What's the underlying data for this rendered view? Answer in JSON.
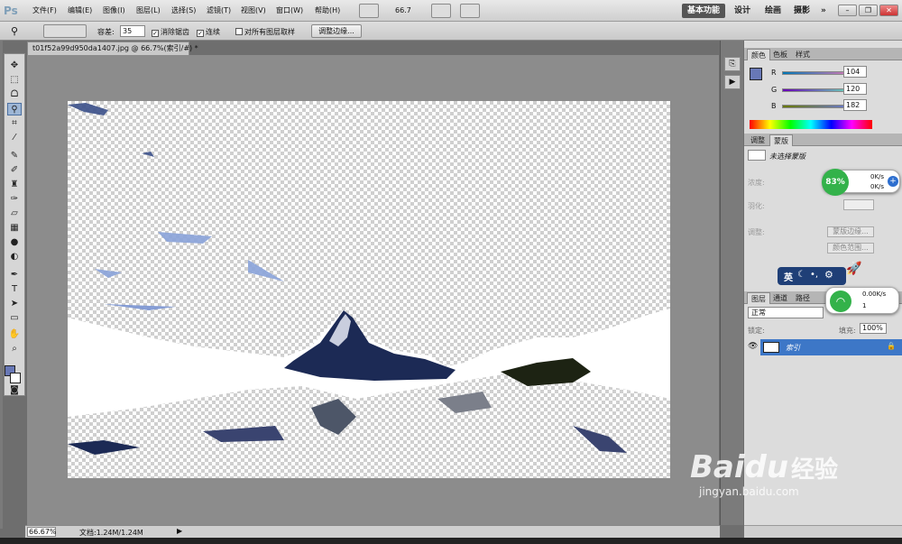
{
  "app": {
    "logo": "Ps",
    "zoom_display": "66.7"
  },
  "menus": [
    "文件(F)",
    "编辑(E)",
    "图像(I)",
    "图层(L)",
    "选择(S)",
    "滤镜(T)",
    "视图(V)",
    "窗口(W)",
    "帮助(H)"
  ],
  "workspaces": [
    "基本功能",
    "设计",
    "绘画",
    "摄影"
  ],
  "more_label": "»",
  "options": {
    "tolerance_label": "容差:",
    "tolerance_value": "35",
    "antialias_label": "消除锯齿",
    "contiguous_label": "连续",
    "sample_all_label": "对所有图层取样",
    "refine_label": "调整边缘..."
  },
  "document": {
    "tab_title": "t01f52a99d950da1407.jpg @ 66.7%(索引/#) *"
  },
  "status": {
    "zoom": "66.67%",
    "doc_size": "文档:1.24M/1.24M"
  },
  "color_panel": {
    "tabs": [
      "颜色",
      "色板",
      "样式"
    ],
    "r_label": "R",
    "r_value": "104",
    "g_label": "G",
    "g_value": "120",
    "b_label": "B",
    "b_value": "182",
    "fg_color": "#6878b6"
  },
  "adjust_panel": {
    "tabs": [
      "调整",
      "蒙版"
    ],
    "mask_label": "未选择蒙版",
    "density_label": "浓度:",
    "feather_label": "羽化:",
    "refine_label": "调整:",
    "mask_edge_btn": "蒙版边缘...",
    "color_range_btn": "颜色范围..."
  },
  "layers_panel": {
    "tabs": [
      "图层",
      "通道",
      "路径"
    ],
    "blend_mode": "正常",
    "lock_label": "锁定:",
    "fill_label": "填充:",
    "fill_value": "100%",
    "layer_name": "索引"
  },
  "overlays": {
    "speed_percent": "83%",
    "up_speed": "0K/s",
    "down_speed": "0K/s",
    "ime_label": "英",
    "wifi_speed": "0.00K/s",
    "wifi_count": "1"
  },
  "watermark": {
    "brand": "Baidu",
    "brand_cn": "经验",
    "url": "jingyan.baidu.com"
  },
  "colors": {
    "accent_selected": "#3d77c7",
    "panel_bg": "#dcdcdc",
    "app_bg": "#6e6e6e"
  }
}
